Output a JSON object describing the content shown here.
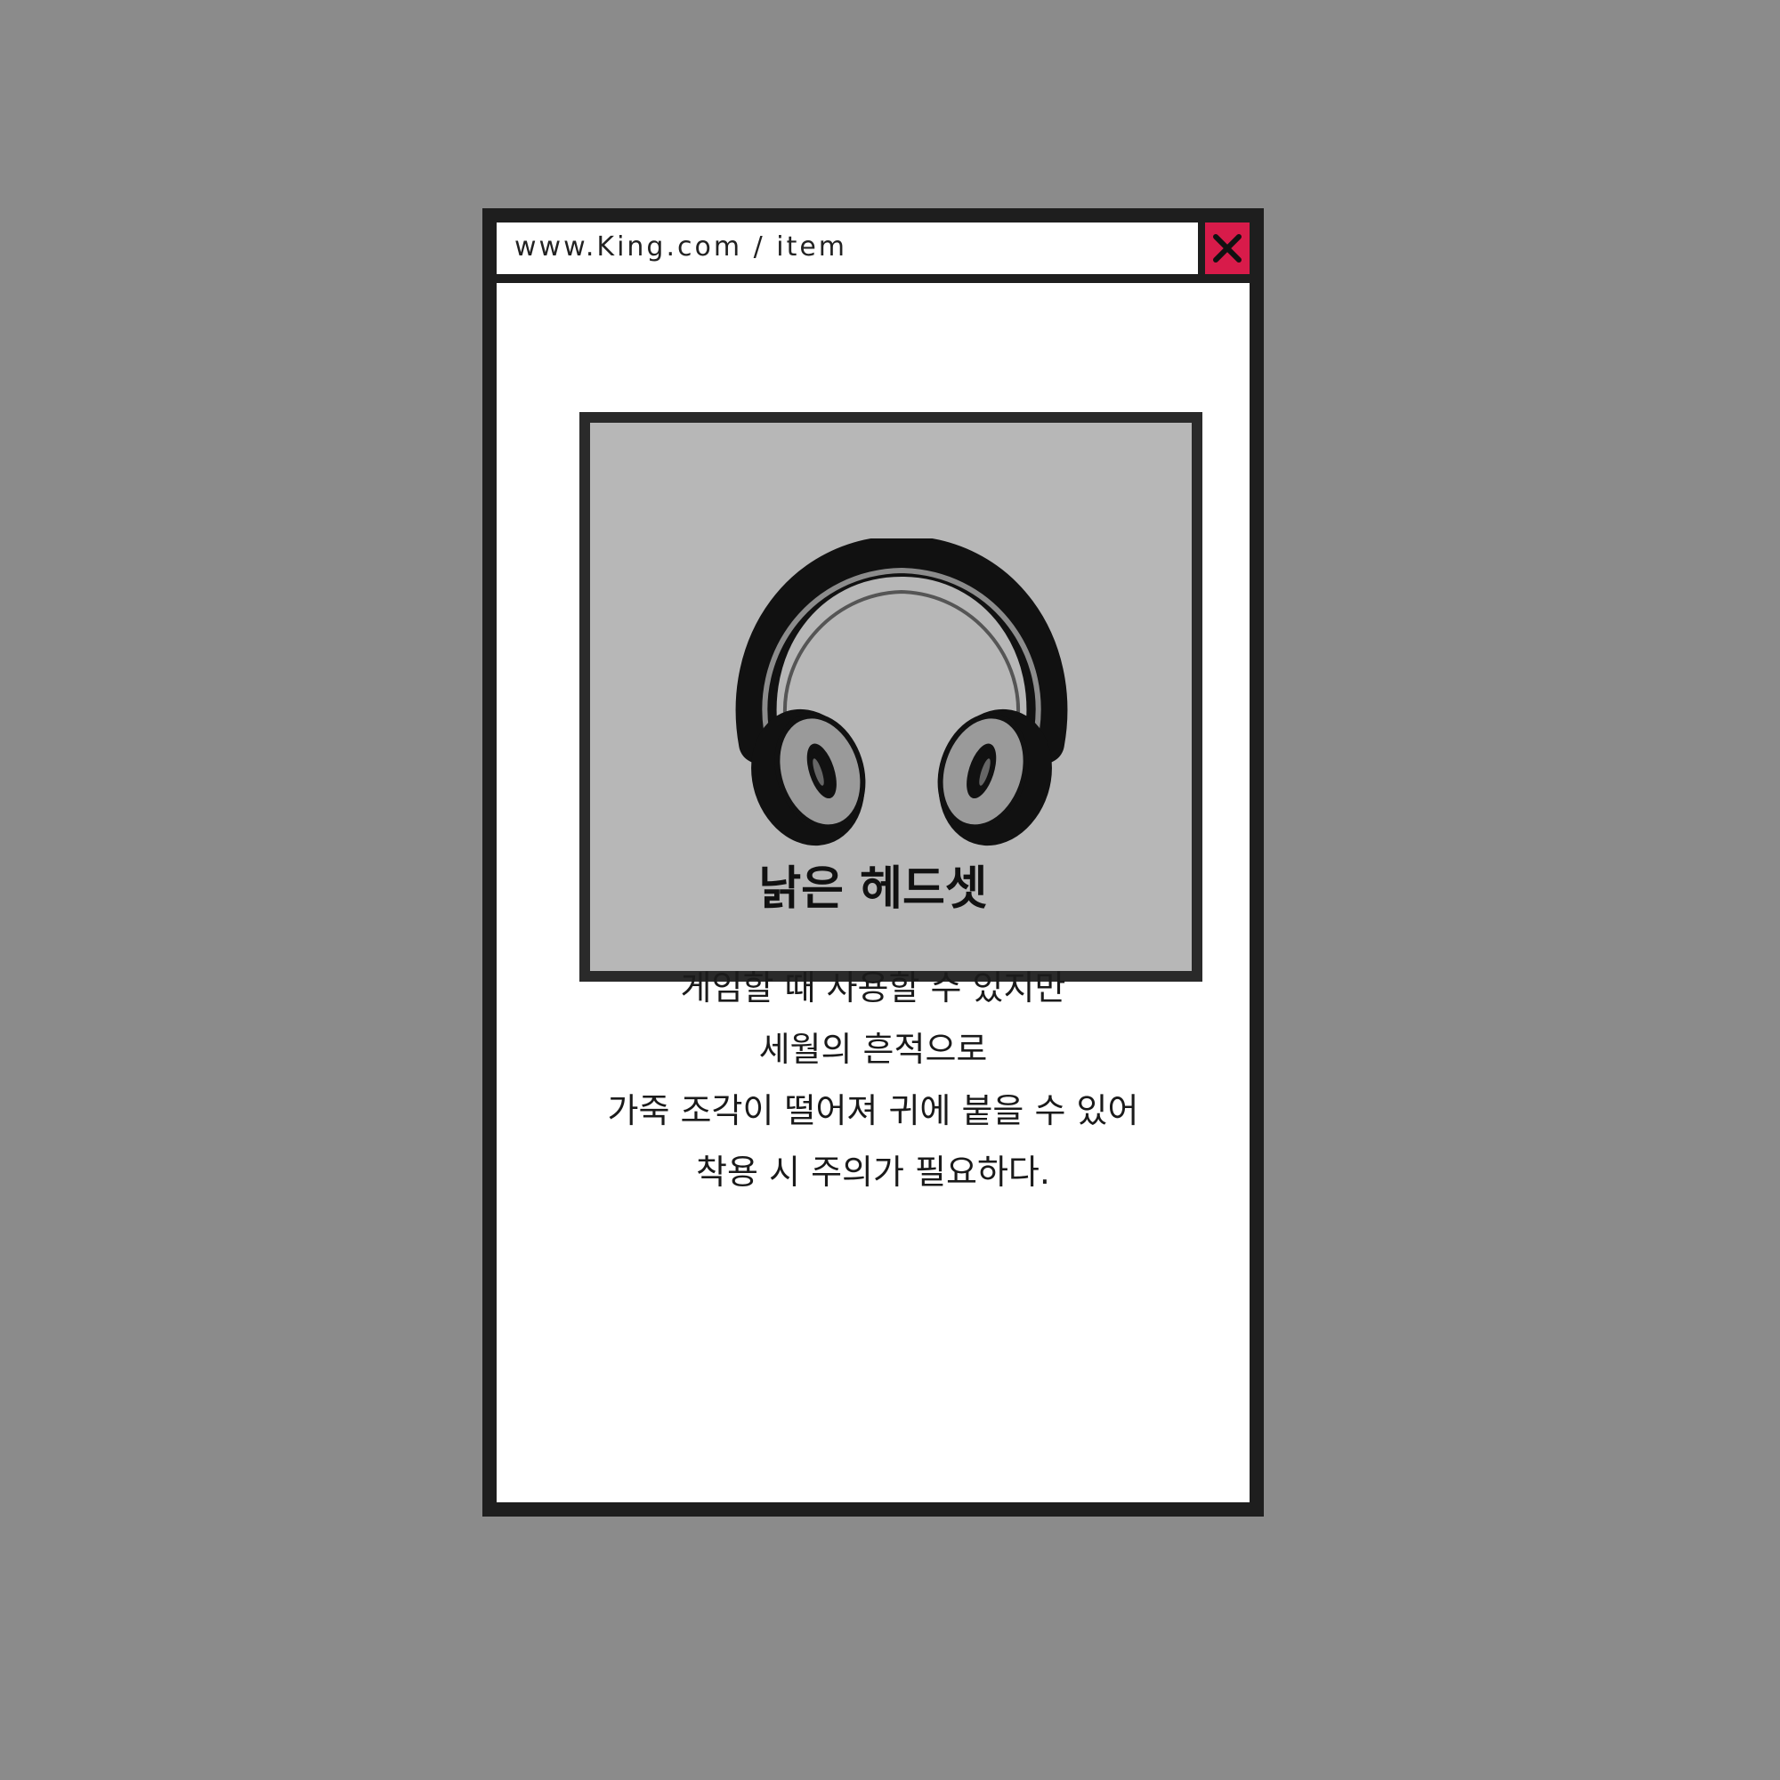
{
  "window": {
    "url": "www.King.com / item",
    "close_icon": "close-icon",
    "close_color": "#d81b4a"
  },
  "item": {
    "image_icon": "headphones-icon",
    "name": "낡은 헤드셋",
    "description_lines": [
      "게임할 때 사용할 수 있지만",
      "세월의 흔적으로",
      "가죽 조각이 떨어져 귀에 붙을 수 있어",
      "착용 시 주의가 필요하다."
    ]
  }
}
